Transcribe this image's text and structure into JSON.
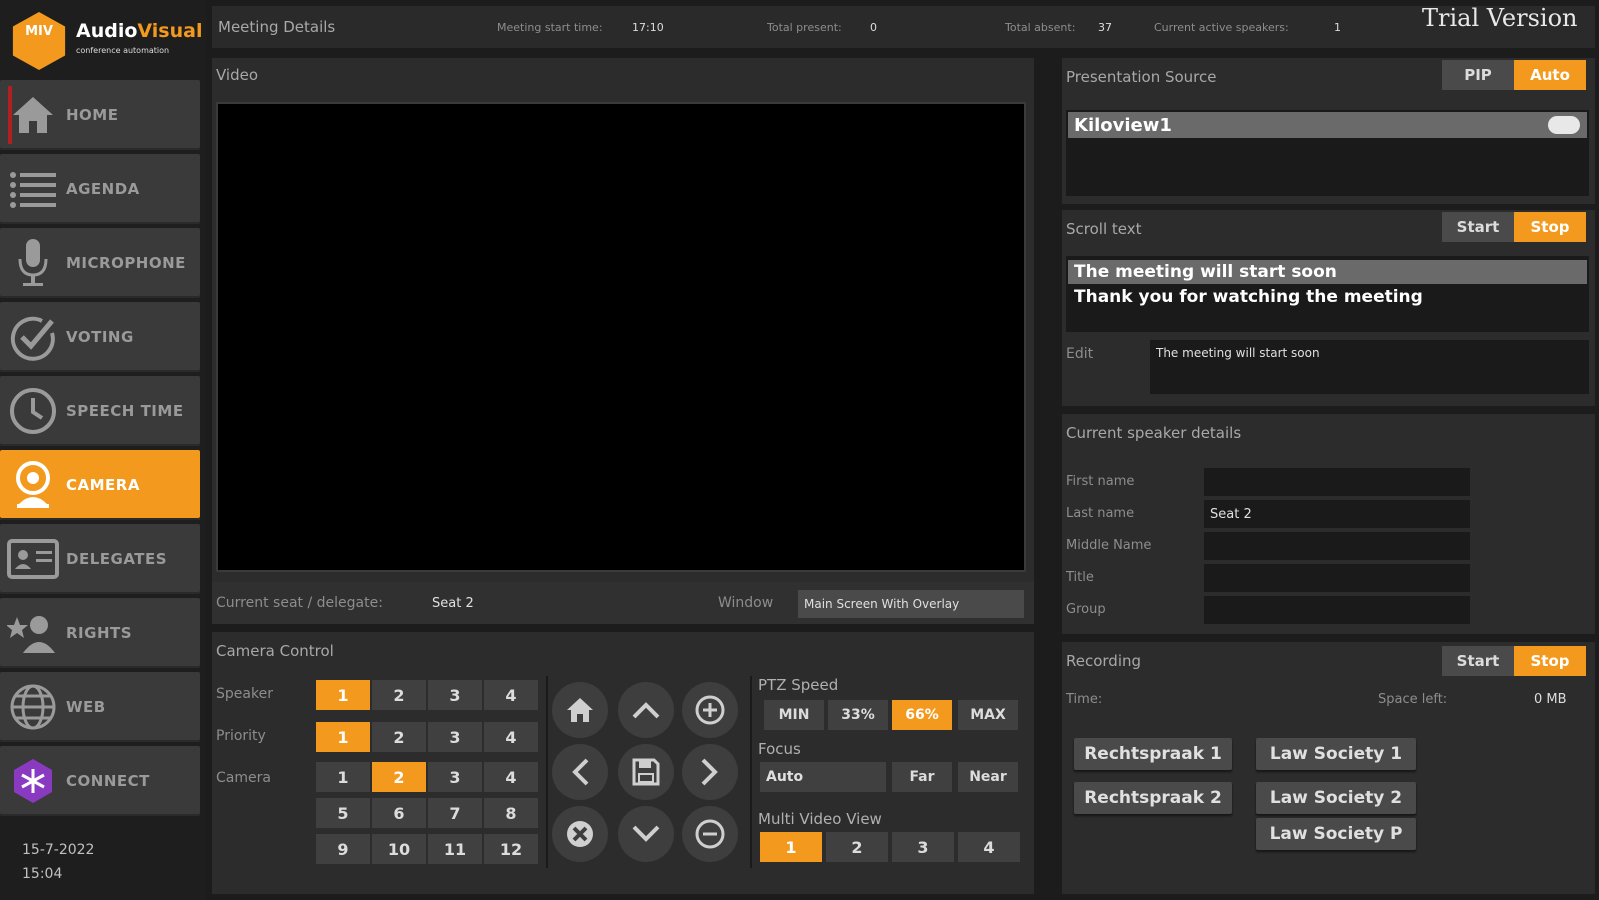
{
  "brand": {
    "mark": "MIV",
    "name_a": "Audio",
    "name_b": "Visual",
    "tagline": "conference automation"
  },
  "nav": [
    {
      "label": "HOME",
      "icon": "home-icon"
    },
    {
      "label": "AGENDA",
      "icon": "list-icon"
    },
    {
      "label": "MICROPHONE",
      "icon": "microphone-icon"
    },
    {
      "label": "VOTING",
      "icon": "check-circle-icon"
    },
    {
      "label": "SPEECH TIME",
      "icon": "clock-icon"
    },
    {
      "label": "CAMERA",
      "icon": "webcam-icon"
    },
    {
      "label": "DELEGATES",
      "icon": "id-card-icon"
    },
    {
      "label": "RIGHTS",
      "icon": "user-star-icon"
    },
    {
      "label": "WEB",
      "icon": "globe-icon"
    },
    {
      "label": "CONNECT",
      "icon": "connect-icon"
    }
  ],
  "datetime": {
    "date": "15-7-2022",
    "time": "15:04"
  },
  "meeting": {
    "title": "Meeting Details",
    "start_label": "Meeting start time:",
    "start_value": "17:10",
    "present_label": "Total present:",
    "present_value": "0",
    "absent_label": "Total absent:",
    "absent_value": "37",
    "speakers_label": "Current active speakers:",
    "speakers_value": "1",
    "watermark": "Trial Version"
  },
  "video": {
    "title": "Video",
    "seat_label": "Current seat / delegate:",
    "seat_value": "Seat 2",
    "window_label": "Window",
    "window_value": "Main Screen With Overlay"
  },
  "presentation": {
    "title": "Presentation Source",
    "pip": "PIP",
    "auto": "Auto",
    "source": "Kiloview1"
  },
  "scroll": {
    "title": "Scroll text",
    "start": "Start",
    "stop": "Stop",
    "items": [
      "The meeting will start soon",
      "Thank you for watching the meeting"
    ],
    "edit_label": "Edit",
    "edit_value": "The meeting will start soon"
  },
  "speaker": {
    "title": "Current speaker details",
    "fields": [
      {
        "label": "First name",
        "value": ""
      },
      {
        "label": "Last name",
        "value": "Seat 2"
      },
      {
        "label": "Middle Name",
        "value": ""
      },
      {
        "label": "Title",
        "value": ""
      },
      {
        "label": "Group",
        "value": ""
      }
    ]
  },
  "camera": {
    "title": "Camera Control",
    "speaker_label": "Speaker",
    "priority_label": "Priority",
    "camera_label": "Camera",
    "speaker": [
      "1",
      "2",
      "3",
      "4"
    ],
    "speaker_active": "1",
    "priority": [
      "1",
      "2",
      "3",
      "4"
    ],
    "priority_active": "1",
    "cameras": [
      "1",
      "2",
      "3",
      "4",
      "5",
      "6",
      "7",
      "8",
      "9",
      "10",
      "11",
      "12"
    ],
    "camera_active": "2",
    "ptz_label": "PTZ Speed",
    "ptz": [
      "MIN",
      "33%",
      "66%",
      "MAX"
    ],
    "ptz_active": "66%",
    "focus_label": "Focus",
    "focus_value": "Auto",
    "far": "Far",
    "near": "Near",
    "mvv_label": "Multi Video View",
    "mvv": [
      "1",
      "2",
      "3",
      "4"
    ],
    "mvv_active": "1"
  },
  "recording": {
    "title": "Recording",
    "start": "Start",
    "stop": "Stop",
    "time_label": "Time:",
    "space_label": "Space left:",
    "space_value": "0 MB",
    "buttons": [
      "Rechtspraak 1",
      "Law Society 1",
      "Rechtspraak 2",
      "Law Society 2",
      "Law Society P"
    ]
  },
  "colors": {
    "accent": "#f39a1e",
    "panel": "#2c2c2c",
    "background": "#1c1c1c"
  }
}
